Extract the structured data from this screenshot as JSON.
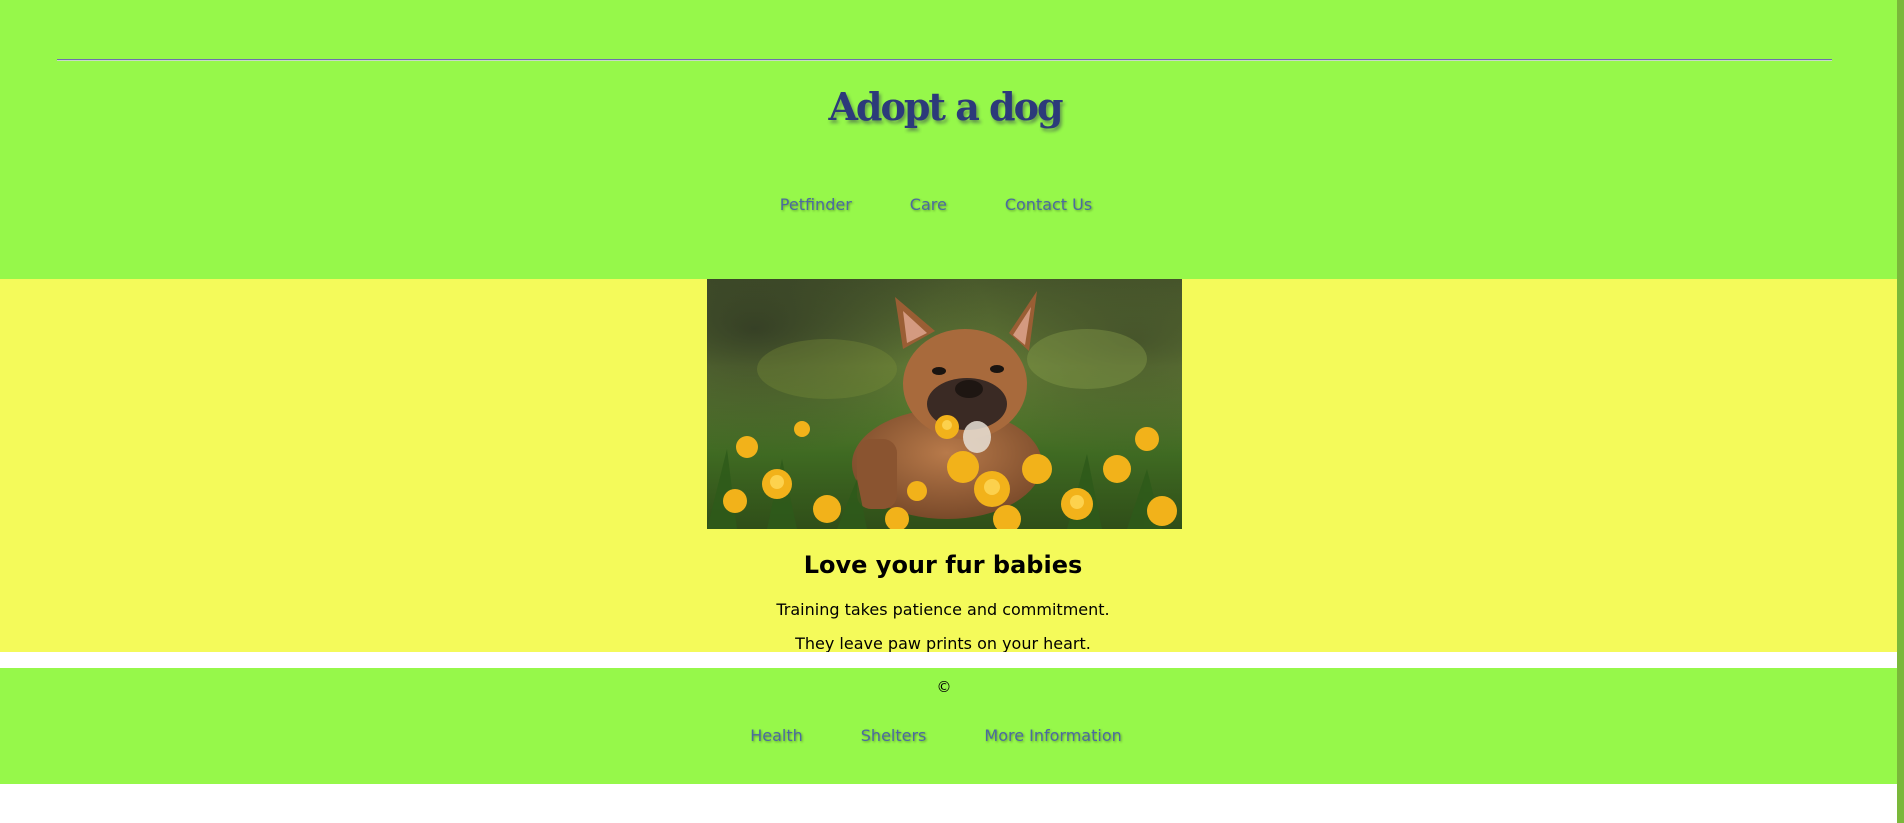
{
  "header": {
    "title": "Adopt a dog",
    "nav": [
      {
        "label": "Petfinder"
      },
      {
        "label": "Care"
      },
      {
        "label": "Contact Us"
      }
    ]
  },
  "hero": {
    "image_alt": "French bulldog sitting among yellow dandelions",
    "heading": "Love your fur babies",
    "lines": [
      "Training takes patience and commitment.",
      "They leave paw prints on your heart."
    ]
  },
  "footer": {
    "copyright": "©",
    "links": [
      {
        "label": "Health"
      },
      {
        "label": "Shelters"
      },
      {
        "label": "More Information"
      }
    ]
  },
  "colors": {
    "header_bg": "#96f84a",
    "hero_bg": "#f4fa5a",
    "footer_bg": "#96f84a",
    "title_color": "#2c3a7a",
    "link_color": "#4c6aa0"
  }
}
